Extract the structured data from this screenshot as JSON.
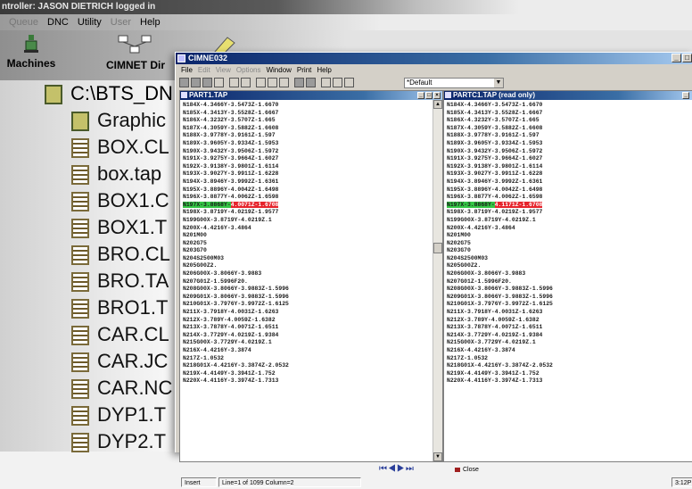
{
  "background_app": {
    "title": "ntroller: JASON DIETRICH logged in",
    "menu": [
      {
        "label": "Queue",
        "dim": true
      },
      {
        "label": "DNC",
        "dim": false
      },
      {
        "label": "Utility",
        "dim": false
      },
      {
        "label": "User",
        "dim": true
      },
      {
        "label": "Help",
        "dim": false
      }
    ],
    "toolbar": {
      "machines_label": "Machines",
      "cimnet_label": "CIMNET Dir"
    },
    "tree": {
      "root": "C:\\BTS_DN",
      "items": [
        "Graphic",
        "BOX.CL",
        "box.tap",
        "BOX1.C",
        "BOX1.T",
        "BRO.CL",
        "BRO.TA",
        "BRO1.T",
        "CAR.CL",
        "CAR.JC",
        "CAR.NC",
        "DYP1.T",
        "DYP2.T"
      ]
    }
  },
  "window": {
    "title": "CIMNE032",
    "menu": [
      {
        "label": "File",
        "dim": false
      },
      {
        "label": "Edit",
        "dim": true
      },
      {
        "label": "View",
        "dim": true
      },
      {
        "label": "Options",
        "dim": true
      },
      {
        "label": "Window",
        "dim": false
      },
      {
        "label": "Print",
        "dim": false
      },
      {
        "label": "Help",
        "dim": false
      }
    ],
    "toolbar_select": "*Default",
    "left_pane": {
      "title": "PART1.TAP"
    },
    "right_pane": {
      "title": "PARTC1.TAP (read only)"
    },
    "close_label": "Close",
    "status": {
      "mode": "Insert",
      "position": "Line=1 of 1099 Column=2"
    },
    "clock": "3:12P"
  },
  "code_lines": [
    "N184X-4.3466Y-3.5473Z-1.6670",
    "N185X-4.3413Y-3.5528Z-1.6667",
    "N186X-4.3232Y-3.5707Z-1.665",
    "N187X-4.3059Y-3.5882Z-1.6608",
    "N188X-3.9778Y-3.9161Z-1.597",
    "N189X-3.9605Y-3.9334Z-1.5953",
    "N190X-3.9432Y-3.9506Z-1.5972",
    "N191X-3.9275Y-3.9664Z-1.6027",
    "N192X-3.9138Y-3.9801Z-1.6114",
    "N193X-3.9027Y-3.9911Z-1.6228",
    "N194X-3.8946Y-3.9992Z-1.6361",
    "N195X-3.8896Y-4.0042Z-1.6498",
    "N196X-3.8877Y-4.0062Z-1.6598",
    "N197X-3.8868Y-4.0071Z-1.6708",
    "N198X-3.8719Y-4.0219Z-1.9577",
    "N199G00X-3.8719Y-4.0219Z.1",
    "N200X-4.4216Y-3.4864",
    "N201M00",
    "N202G75",
    "N203G70",
    "N204S2500M03",
    "N205G00Z2.",
    "N206G00X-3.8066Y-3.9883",
    "N207G01Z-1.5996F20.",
    "N208G00X-3.8066Y-3.9883Z-1.5996",
    "N209G01X-3.8066Y-3.9883Z-1.5996",
    "N210G01X-3.7976Y-3.9972Z-1.6125",
    "N211X-3.7918Y-4.0031Z-1.6263",
    "N212X-3.789Y-4.0059Z-1.6382",
    "N213X-3.7878Y-4.0071Z-1.6511",
    "N214X-3.7729Y-4.0219Z-1.9384",
    "N215G00X-3.7729Y-4.0219Z.1",
    "N216X-4.4216Y-3.3874",
    "N217Z-1.0532",
    "N218G01X-4.4216Y-3.3874Z-2.0532",
    "N219X-4.4149Y-3.3941Z-1.752",
    "N220X-4.4116Y-3.3974Z-1.7313"
  ],
  "right_code_lines": [
    "N184X-4.3466Y-3.5473Z-1.6670",
    "N185X-4.3413Y-3.5528Z-1.6667",
    "N186X-4.3232Y-3.5707Z-1.665",
    "N187X-4.3059Y-3.5882Z-1.6608",
    "N188X-3.9778Y-3.9161Z-1.597",
    "N189X-3.9605Y-3.9334Z-1.5953",
    "N190X-3.9432Y-3.9506Z-1.5972",
    "N191X-3.9275Y-3.9664Z-1.6027",
    "N192X-3.9138Y-3.9801Z-1.6114",
    "N193X-3.9027Y-3.9911Z-1.6228",
    "N194X-3.8946Y-3.9992Z-1.6361",
    "N195X-3.8896Y-4.0042Z-1.6498",
    "N196X-3.8877Y-4.0062Z-1.6598",
    "N197X-3.8868Y-4.1171Z-1.6708",
    "N198X-3.8719Y-4.0219Z-1.9577",
    "N199G00X-3.8719Y-4.0219Z.1",
    "N200X-4.4216Y-3.4864",
    "N201M00",
    "N202G75",
    "N203G70",
    "N204S2500M03",
    "N205G00Z2.",
    "N206G00X-3.8066Y-3.9883",
    "N207G01Z-1.5996F20.",
    "N208G00X-3.8066Y-3.9883Z-1.5996",
    "N209G01X-3.8066Y-3.9883Z-1.5996",
    "N210G01X-3.7976Y-3.9972Z-1.6125",
    "N211X-3.7918Y-4.0031Z-1.6263",
    "N212X-3.789Y-4.0059Z-1.6382",
    "N213X-3.7878Y-4.0071Z-1.6511",
    "N214X-3.7729Y-4.0219Z-1.9384",
    "N215G00X-3.7729Y-4.0219Z.1",
    "N216X-4.4216Y-3.3874",
    "N217Z-1.0532",
    "N218G01X-4.4216Y-3.3874Z-2.0532",
    "N219X-4.4149Y-3.3941Z-1.752",
    "N220X-4.4116Y-3.3974Z-1.7313"
  ],
  "highlight": {
    "line_index": 13,
    "left": {
      "green": "N197X-3.8868Y-",
      "red": "4.0071Z-1.6708"
    },
    "right": {
      "green": "N197X-3.8868Y-",
      "red": "4.1171Z-1.6708"
    },
    "colors": {
      "match": "#35c646",
      "diff": "#e6242c"
    }
  },
  "colors": {
    "titlebar": "#0a246a",
    "chrome": "#d4d0c8"
  }
}
